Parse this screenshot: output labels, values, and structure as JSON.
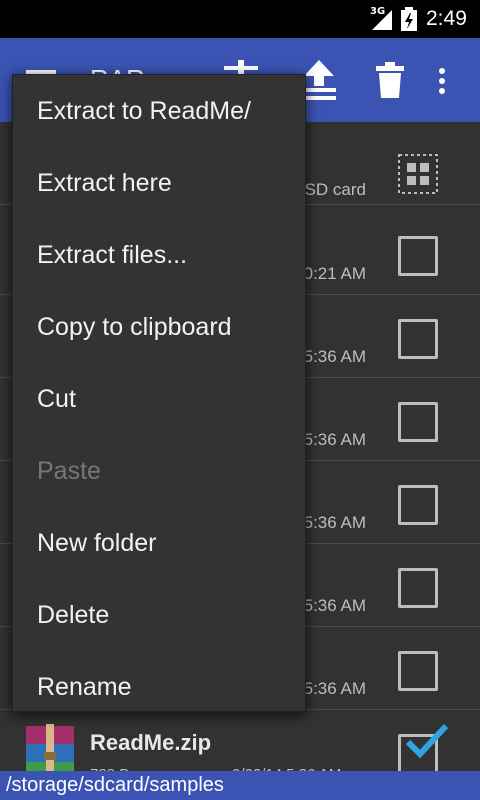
{
  "status_bar": {
    "network": "3G",
    "time": "2:49"
  },
  "action_bar": {
    "title": "RAR",
    "icons": [
      "menu-icon",
      "archive-icon",
      "extract-icon",
      "delete-icon",
      "overflow-icon"
    ]
  },
  "file_list": {
    "rows": [
      {
        "meta": "SD card",
        "checkbox": "select-all"
      },
      {
        "meta": "0:21 AM",
        "checked": false
      },
      {
        "meta": "5:36 AM",
        "checked": false
      },
      {
        "meta": "5:36 AM",
        "checked": false
      },
      {
        "meta": "5:36 AM",
        "checked": false
      },
      {
        "meta": "5:36 AM",
        "checked": false
      },
      {
        "meta": "5:36 AM",
        "checked": false
      },
      {
        "name": "ReadMe.zip",
        "size": "788 B",
        "date": "2/22/14 5:36 AM",
        "checked": true
      }
    ]
  },
  "path": "/storage/sdcard/samples",
  "menu": {
    "items": [
      {
        "label": "Extract to ReadMe/",
        "enabled": true
      },
      {
        "label": "Extract here",
        "enabled": true
      },
      {
        "label": "Extract files...",
        "enabled": true
      },
      {
        "label": "Copy to clipboard",
        "enabled": true
      },
      {
        "label": "Cut",
        "enabled": true
      },
      {
        "label": "Paste",
        "enabled": false
      },
      {
        "label": "New folder",
        "enabled": true
      },
      {
        "label": "Delete",
        "enabled": true
      },
      {
        "label": "Rename",
        "enabled": true
      }
    ]
  },
  "colors": {
    "accent": "#3b53b3",
    "check": "#2fa3e6",
    "background": "#323232"
  }
}
